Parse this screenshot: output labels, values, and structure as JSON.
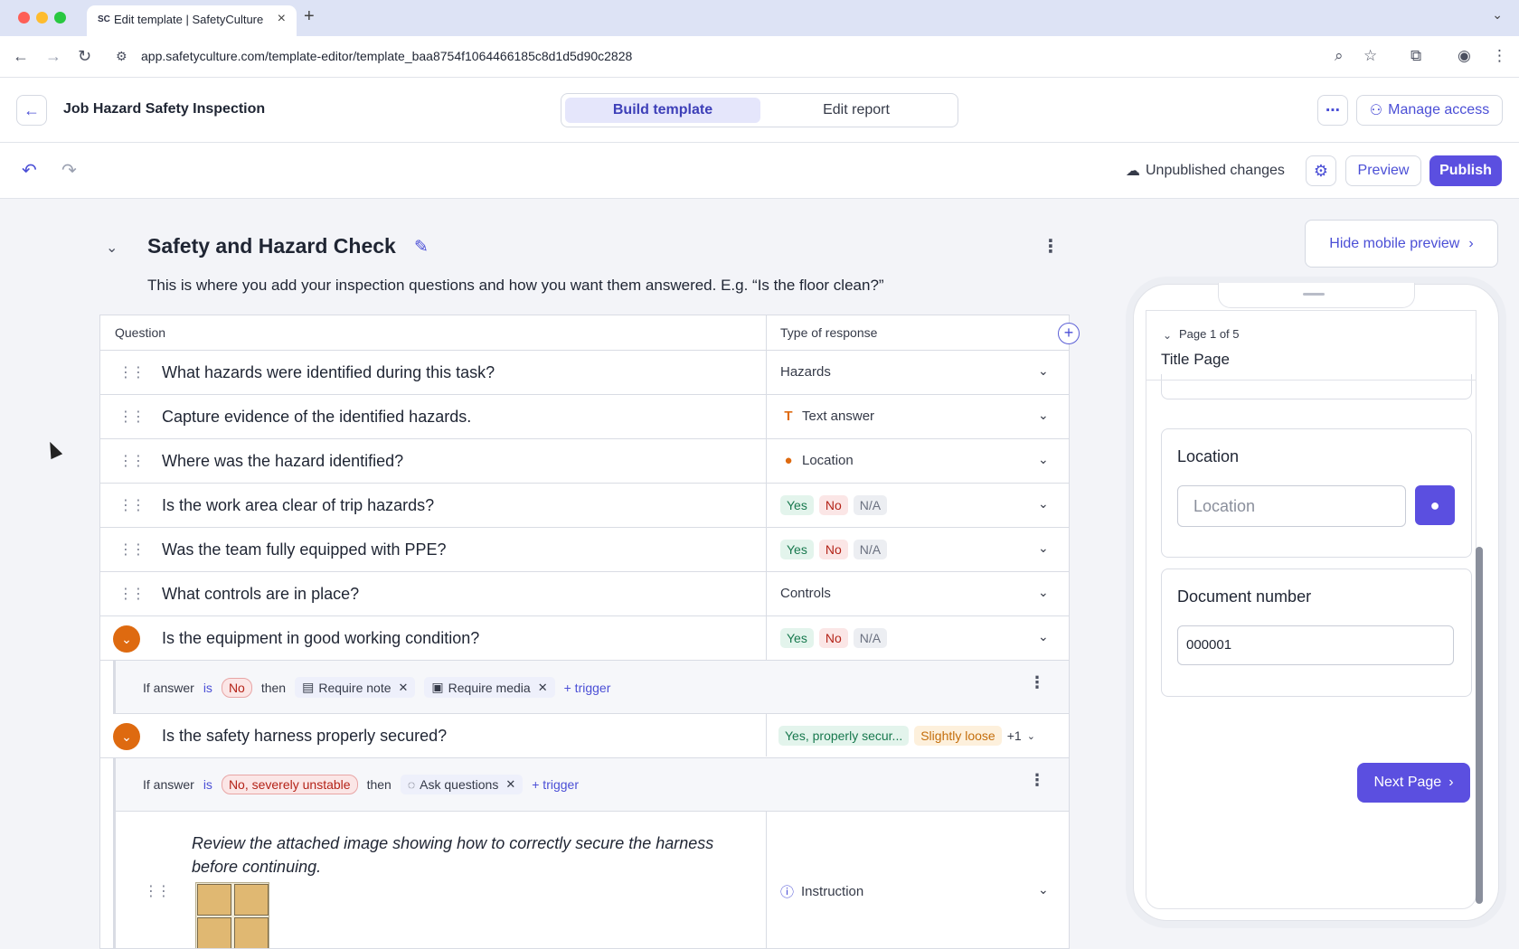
{
  "browser": {
    "tab_title": "Edit template | SafetyCulture",
    "tab_favicon": "SC",
    "url": "app.safetyculture.com/template-editor/template_baa8754f1064466185c8d1d5d90c2828"
  },
  "header": {
    "doc_title": "Job Hazard Safety Inspection",
    "tabs": [
      "Build template",
      "Edit report"
    ],
    "manage_access": "Manage access"
  },
  "toolbar": {
    "status": "Unpublished changes",
    "preview": "Preview",
    "publish": "Publish"
  },
  "section": {
    "title": "Safety and Hazard Check",
    "description": "This is where you add your inspection questions and how you want them answered. E.g. “Is the floor clean?”"
  },
  "table": {
    "col_question": "Question",
    "col_response": "Type of response",
    "rows": [
      {
        "question": "What hazards were identified during this task?",
        "response": "Hazards"
      },
      {
        "question": "Capture evidence of the identified hazards.",
        "response": "Text answer"
      },
      {
        "question": "Where was the hazard identified?",
        "response": "Location"
      },
      {
        "question": "Is the work area clear of trip hazards?",
        "yes": "Yes",
        "no": "No",
        "na": "N/A"
      },
      {
        "question": "Was the team fully equipped with PPE?",
        "yes": "Yes",
        "no": "No",
        "na": "N/A"
      },
      {
        "question": "What controls are in place?",
        "response": "Controls"
      },
      {
        "question": "Is the equipment in good working condition?",
        "yes": "Yes",
        "no": "No",
        "na": "N/A"
      },
      {
        "question": "Is the safety harness properly secured?",
        "opt1": "Yes, properly secur...",
        "opt2": "Slightly loose",
        "more": "+1"
      }
    ],
    "logic1": {
      "if": "If answer",
      "is": "is",
      "answer": "No",
      "then": "then",
      "chip1": "Require note",
      "chip2": "Require media",
      "add": "+ trigger"
    },
    "logic2": {
      "if": "If answer",
      "is": "is",
      "answer": "No, severely unstable",
      "then": "then",
      "chip1": "Ask questions",
      "add": "+ trigger"
    },
    "instruction": {
      "text": "Review the attached image showing how to correctly secure the harness before continuing.",
      "response": "Instruction"
    }
  },
  "mobile": {
    "hide_label": "Hide mobile preview",
    "page_of": "Page 1 of 5",
    "page_title": "Title Page",
    "location_label": "Location",
    "location_placeholder": "Location",
    "docnum_label": "Document number",
    "docnum_value": "000001",
    "next_page": "Next Page"
  },
  "colors": {
    "accent": "#5b4fe0",
    "orange": "#de6a10"
  }
}
